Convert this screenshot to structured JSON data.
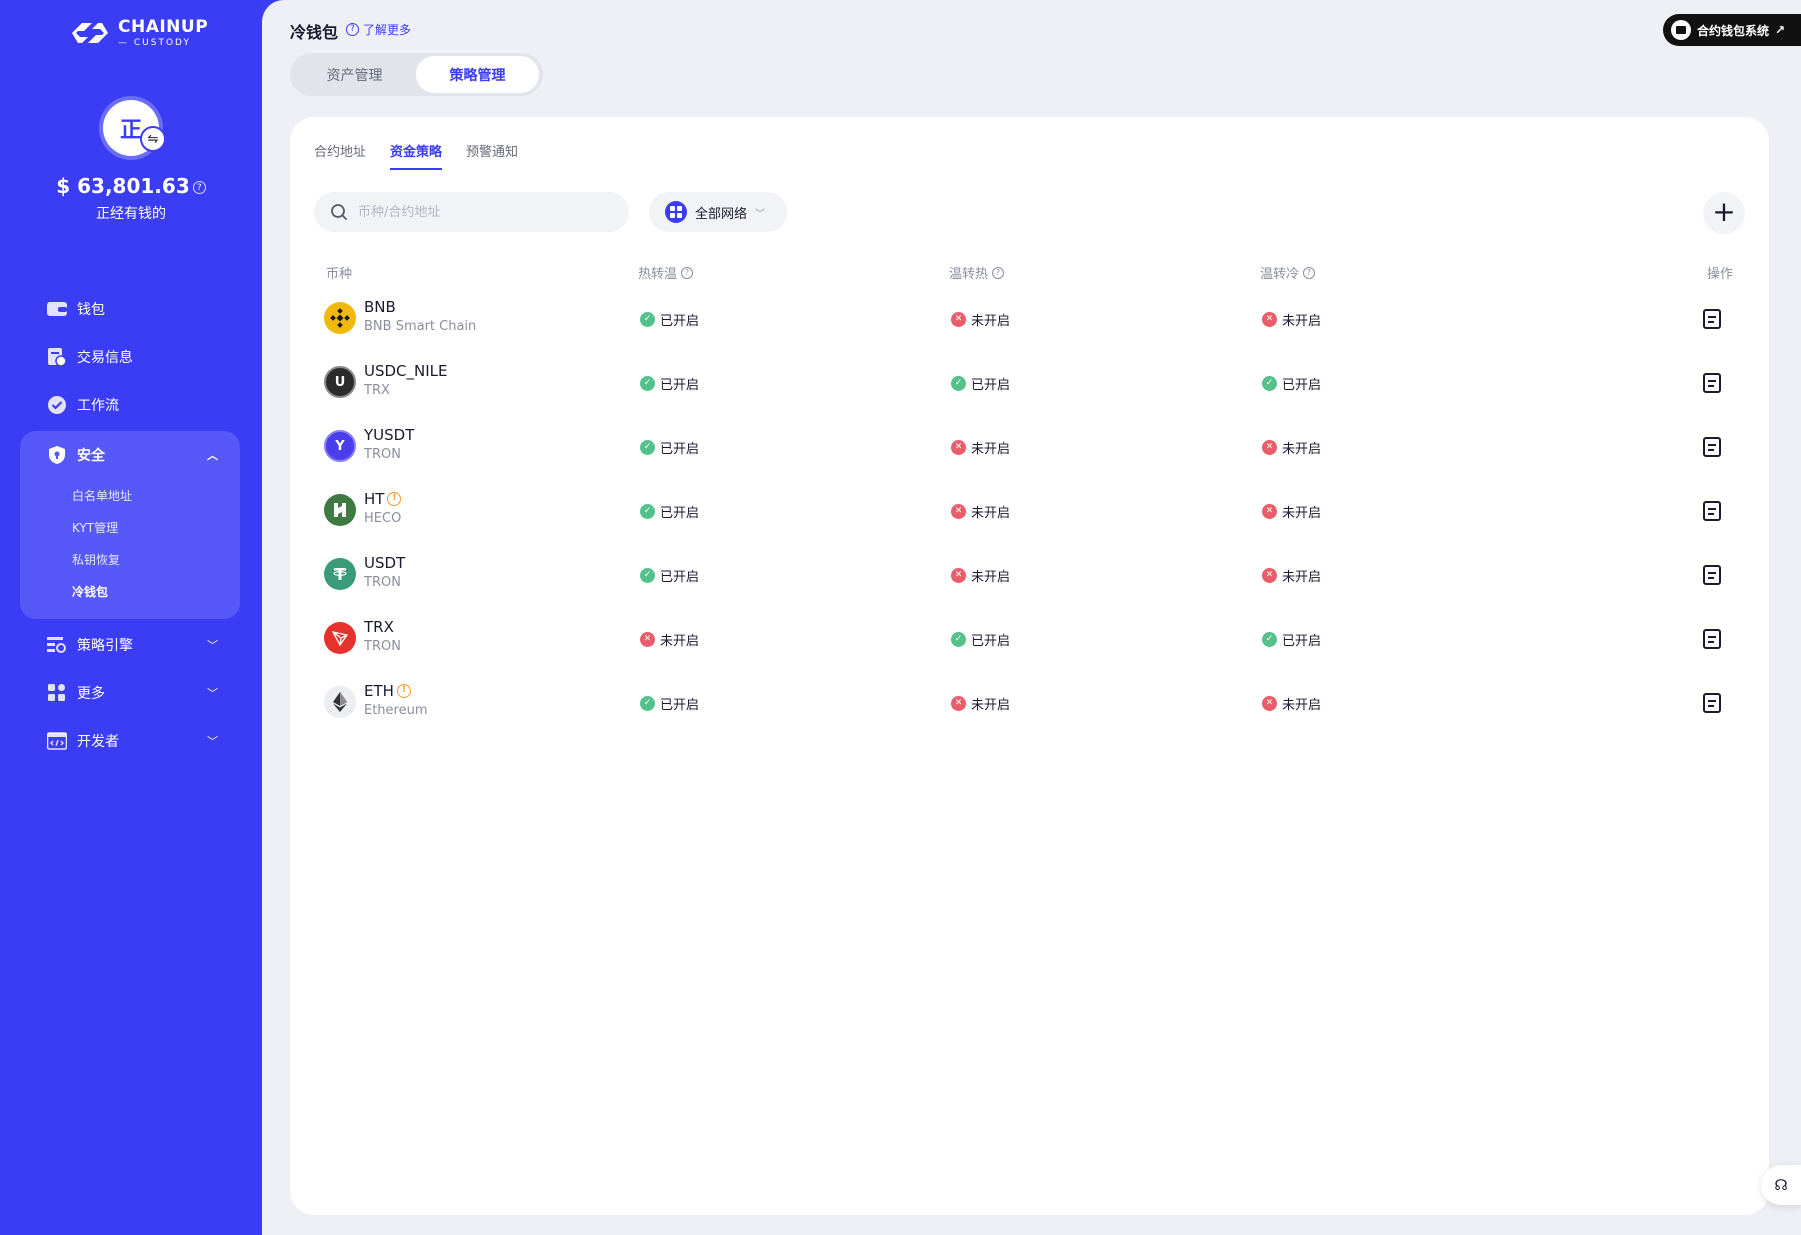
{
  "brand": {
    "line1": "CHAINUP",
    "line2": "— CUSTODY"
  },
  "account": {
    "avatar_char": "正",
    "balance": "$ 63,801.63",
    "name": "正经有钱的"
  },
  "sidebar": {
    "items": [
      {
        "label": "钱包"
      },
      {
        "label": "交易信息"
      },
      {
        "label": "工作流"
      }
    ],
    "security": {
      "label": "安全",
      "subitems": [
        "白名单地址",
        "KYT管理",
        "私钥恢复",
        "冷钱包"
      ]
    },
    "collapsed": [
      {
        "label": "策略引擎"
      },
      {
        "label": "更多"
      },
      {
        "label": "开发者"
      }
    ]
  },
  "header": {
    "title": "冷钱包",
    "learn_more": "了解更多",
    "external_button": "合约钱包系统"
  },
  "segments": [
    "资产管理",
    "策略管理"
  ],
  "sub_tabs": [
    "合约地址",
    "资金策略",
    "预警通知"
  ],
  "search": {
    "placeholder": "币种/合约地址"
  },
  "network_select": {
    "value": "全部网络"
  },
  "table": {
    "columns": [
      "币种",
      "热转温",
      "温转热",
      "温转冷",
      "操作"
    ],
    "rows": [
      {
        "coin": "BNB",
        "chain": "BNB Smart Chain",
        "warn": false,
        "hot_to_warm": "已开启",
        "warm_to_hot": "未开启",
        "warm_to_cold": "未开启"
      },
      {
        "coin": "USDC_NILE",
        "chain": "TRX",
        "warn": false,
        "hot_to_warm": "已开启",
        "warm_to_hot": "已开启",
        "warm_to_cold": "已开启"
      },
      {
        "coin": "YUSDT",
        "chain": "TRON",
        "warn": false,
        "hot_to_warm": "已开启",
        "warm_to_hot": "未开启",
        "warm_to_cold": "未开启"
      },
      {
        "coin": "HT",
        "chain": "HECO",
        "warn": true,
        "hot_to_warm": "已开启",
        "warm_to_hot": "未开启",
        "warm_to_cold": "未开启"
      },
      {
        "coin": "USDT",
        "chain": "TRON",
        "warn": false,
        "hot_to_warm": "已开启",
        "warm_to_hot": "未开启",
        "warm_to_cold": "未开启"
      },
      {
        "coin": "TRX",
        "chain": "TRON",
        "warn": false,
        "hot_to_warm": "未开启",
        "warm_to_hot": "已开启",
        "warm_to_cold": "已开启"
      },
      {
        "coin": "ETH",
        "chain": "Ethereum",
        "warn": true,
        "hot_to_warm": "已开启",
        "warm_to_hot": "未开启",
        "warm_to_cold": "未开启"
      }
    ]
  },
  "colors": {
    "accent": "#3b3df4",
    "enabled": "#57c18b",
    "disabled": "#e75d6a",
    "warning": "#f29a2e"
  },
  "icons": {
    "coin_icons": [
      "bnb-icon",
      "usdc-nile-icon",
      "yusdt-icon",
      "ht-icon",
      "usdt-icon",
      "trx-icon",
      "eth-icon"
    ],
    "sidebar_icons": [
      "wallet-icon",
      "transaction-icon",
      "workflow-icon",
      "shield-icon",
      "strategy-icon",
      "more-icon",
      "developer-icon"
    ]
  }
}
